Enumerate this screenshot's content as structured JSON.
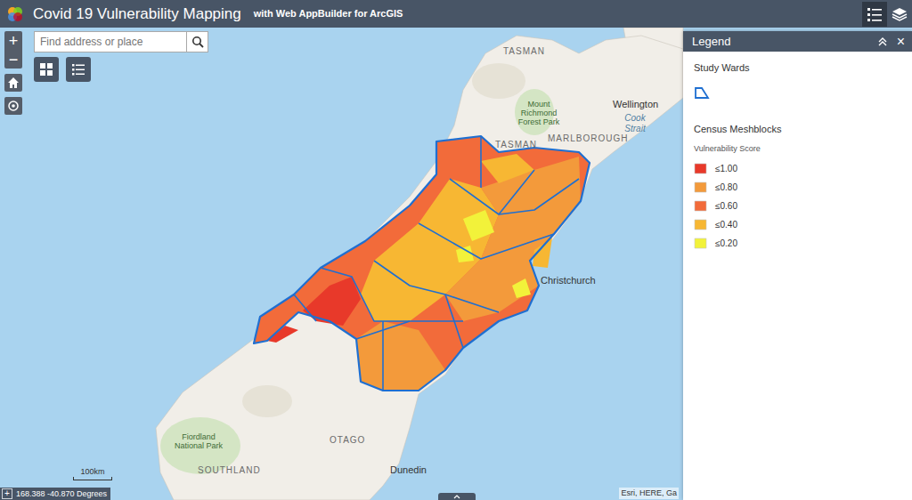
{
  "header": {
    "title": "Covid 19 Vulnerability Mapping",
    "subtitle": "with Web AppBuilder for ArcGIS",
    "tools": [
      {
        "kind": "legend",
        "selected": true
      },
      {
        "kind": "layers",
        "selected": false
      }
    ]
  },
  "map_controls": {
    "zoom_in": "+",
    "zoom_out": "−"
  },
  "search": {
    "placeholder": "Find address or place"
  },
  "legend": {
    "title": "Legend",
    "close": "×",
    "layers": [
      {
        "title": "Study Wards"
      },
      {
        "title": "Census Meshblocks",
        "field": "Vulnerability Score",
        "classes": [
          {
            "label": "≤1.00",
            "color": "#e8392a"
          },
          {
            "label": "≤0.80",
            "color": "#f39a3b"
          },
          {
            "label": "≤0.60",
            "color": "#f26b3a"
          },
          {
            "label": "≤0.40",
            "color": "#f7b733"
          },
          {
            "label": "≤0.20",
            "color": "#f2f23a"
          }
        ]
      }
    ]
  },
  "map": {
    "labels": [
      {
        "text": "TASMAN",
        "kind": "region"
      },
      {
        "text": "Wellington",
        "kind": "city"
      },
      {
        "text": "Mount Richmond Forest Park",
        "kind": "park"
      },
      {
        "text": "MARLBOROUGH",
        "kind": "region"
      },
      {
        "text": "Cook Strait",
        "kind": "water"
      },
      {
        "text": "TASMAN",
        "kind": "region"
      },
      {
        "text": "Christchurch",
        "kind": "city"
      },
      {
        "text": "OTAGO",
        "kind": "region"
      },
      {
        "text": "Fiordland National Park",
        "kind": "park"
      },
      {
        "text": "SOUTHLAND",
        "kind": "region"
      },
      {
        "text": "Dunedin",
        "kind": "city"
      }
    ],
    "scale": "100km",
    "coordinates_toggle": "+",
    "coordinates": "168.388 -40.870 Degrees",
    "attribution": "Esri, HERE, Ga"
  }
}
